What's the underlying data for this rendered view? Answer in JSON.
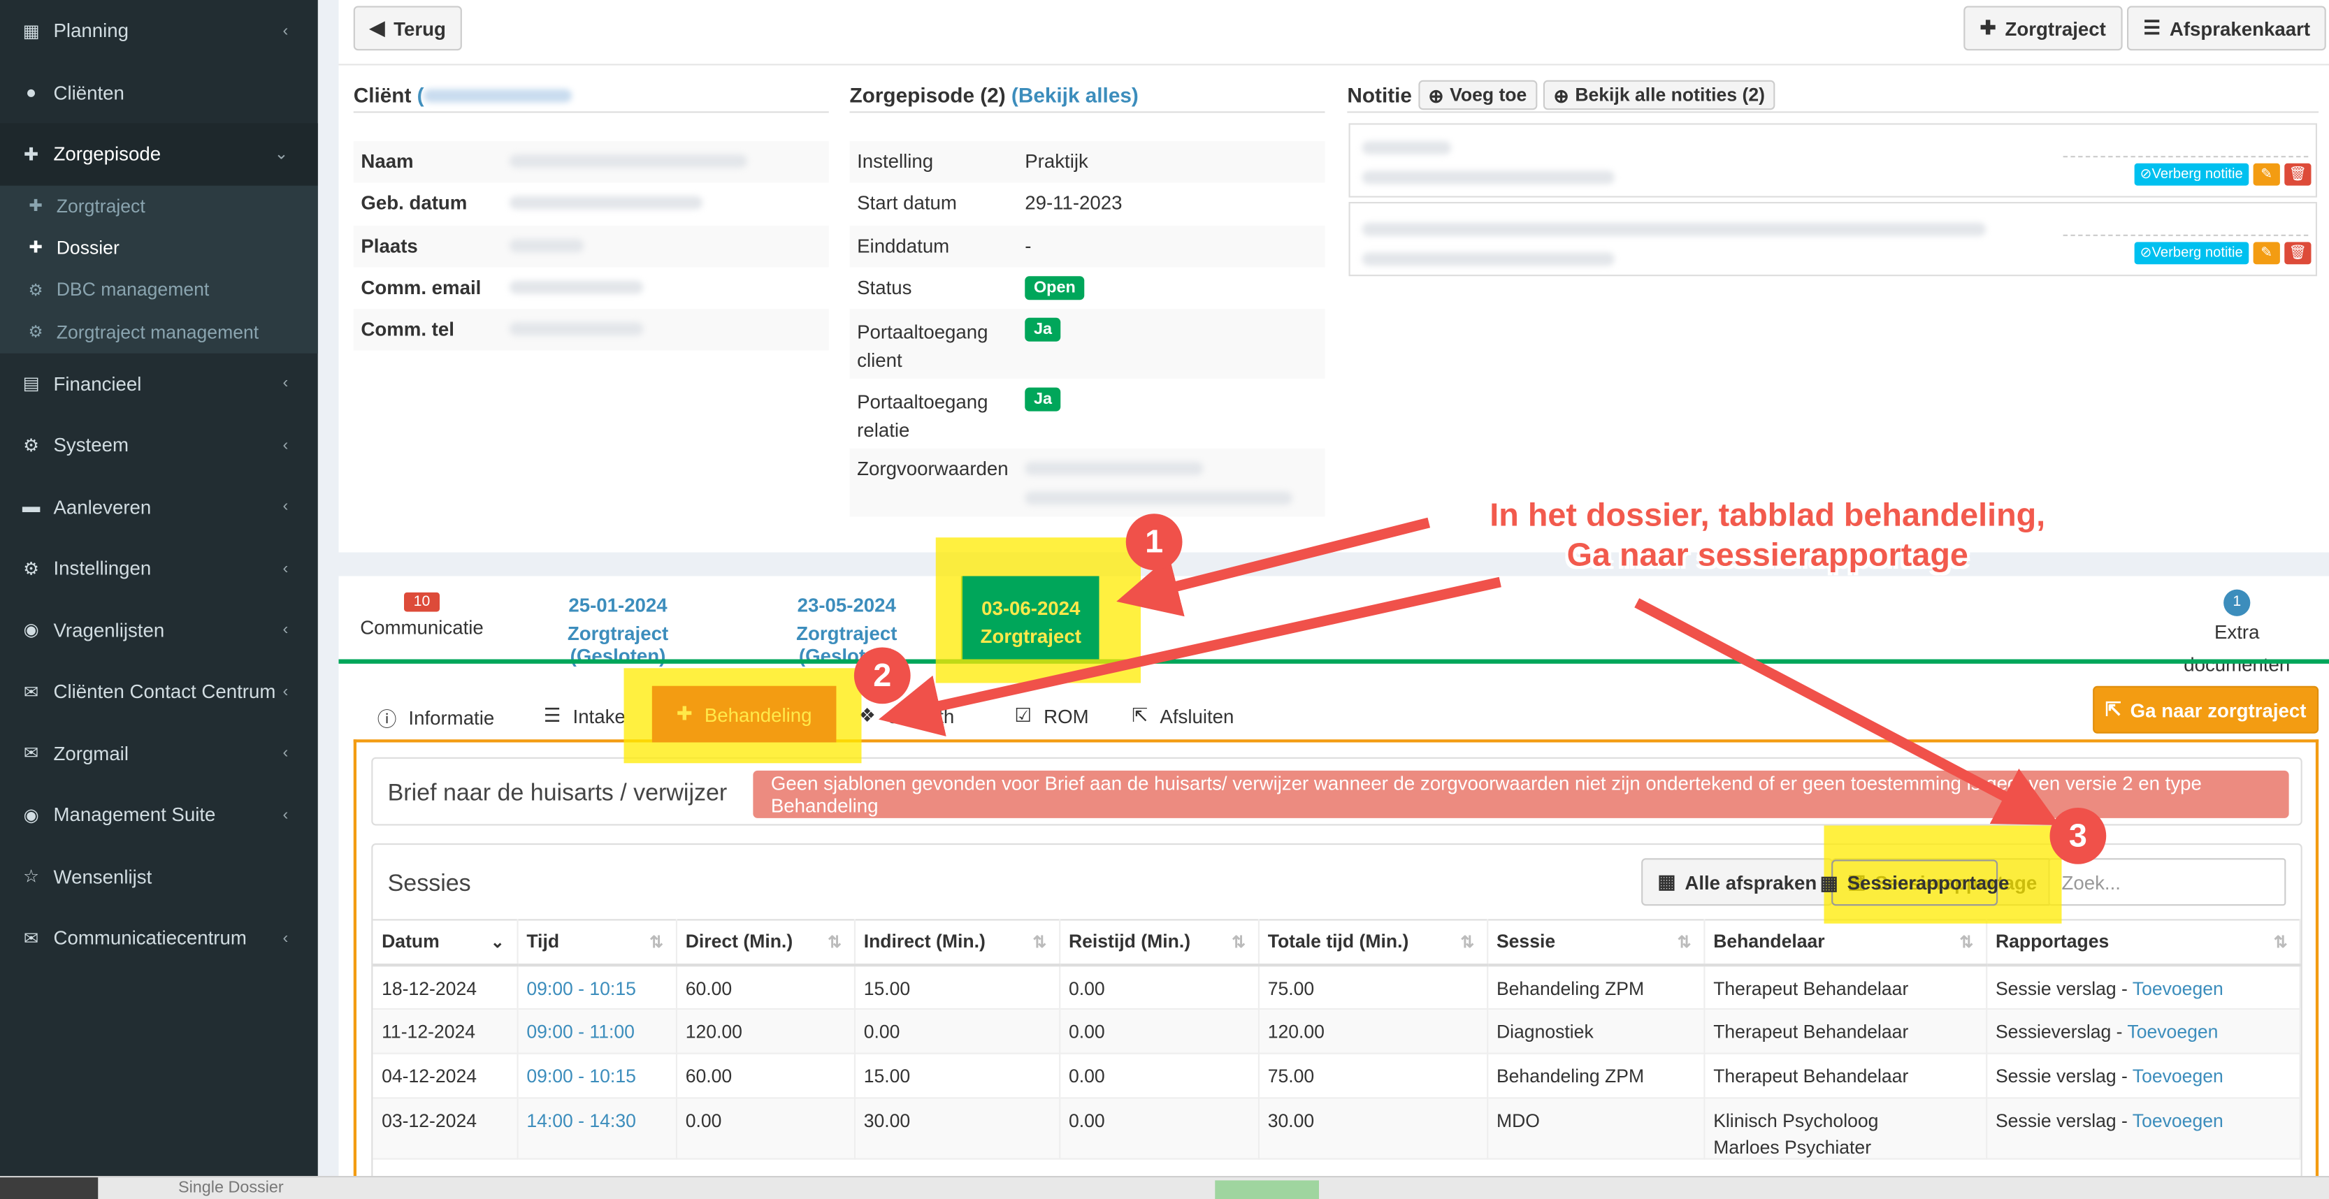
{
  "sidebar": {
    "items": [
      {
        "label": "Planning",
        "icon": "calendar-icon",
        "glyph": "▦",
        "chevron": "‹"
      },
      {
        "label": "Cliënten",
        "icon": "user-icon",
        "glyph": "●",
        "chevron": ""
      },
      {
        "label": "Zorgepisode",
        "icon": "medkit-icon",
        "glyph": "✚",
        "chevron": "⌄"
      },
      {
        "label": "Financieel",
        "icon": "book-icon",
        "glyph": "▤",
        "chevron": "‹"
      },
      {
        "label": "Systeem",
        "icon": "cogs-icon",
        "glyph": "⚙",
        "chevron": "‹"
      },
      {
        "label": "Aanleveren",
        "icon": "truck-icon",
        "glyph": "▬",
        "chevron": "‹"
      },
      {
        "label": "Instellingen",
        "icon": "gear-icon",
        "glyph": "⚙",
        "chevron": "‹"
      },
      {
        "label": "Vragenlijsten",
        "icon": "globe-icon",
        "glyph": "◉",
        "chevron": "‹"
      },
      {
        "label": "Cliënten Contact Centrum",
        "icon": "envelope-icon",
        "glyph": "✉",
        "chevron": "‹"
      },
      {
        "label": "Zorgmail",
        "icon": "envelope-icon",
        "glyph": "✉",
        "chevron": "‹"
      },
      {
        "label": "Management Suite",
        "icon": "globe-icon",
        "glyph": "◉",
        "chevron": "‹"
      },
      {
        "label": "Wensenlijst",
        "icon": "star-icon",
        "glyph": "☆",
        "chevron": ""
      },
      {
        "label": "Communicatiecentrum",
        "icon": "envelope-icon",
        "glyph": "✉",
        "chevron": "‹"
      }
    ],
    "subitems": [
      {
        "label": "Zorgtraject",
        "glyph": "✚"
      },
      {
        "label": "Dossier",
        "glyph": "✚"
      },
      {
        "label": "DBC management",
        "glyph": "⚙"
      },
      {
        "label": "Zorgtraject management",
        "glyph": "⚙"
      }
    ]
  },
  "header": {
    "back_label": "Terug",
    "zorgtraject_label": "Zorgtraject",
    "afsprakenkaart_label": "Afsprakenkaart"
  },
  "client": {
    "title": "Cliënt",
    "paren_open": "(",
    "fields": [
      "Naam",
      "Geb. datum",
      "Plaats",
      "Comm. email",
      "Comm. tel"
    ]
  },
  "episode": {
    "title": "Zorgepisode (2)",
    "link": "(Bekijk alles)",
    "rows": [
      {
        "k": "Instelling",
        "v": "Praktijk"
      },
      {
        "k": "Start datum",
        "v": "29-11-2023"
      },
      {
        "k": "Einddatum",
        "v": "-"
      },
      {
        "k": "Status",
        "badge": "Open"
      },
      {
        "k": "Portaaltoegang client",
        "badge": "Ja"
      },
      {
        "k": "Portaaltoegang relatie",
        "badge": "Ja"
      },
      {
        "k": "Zorgvoorwaarden",
        "v": ""
      }
    ]
  },
  "notitie": {
    "title": "Notitie",
    "add_label": "Voeg toe",
    "view_all_label": "Bekijk alle notities (2)",
    "hide_label": "Verberg notitie"
  },
  "tabs": {
    "communicatie": {
      "badge": "10",
      "label": "Communicatie"
    },
    "t1": {
      "date": "25-01-2024",
      "label": "Zorgtraject (Gesloten)"
    },
    "t2": {
      "date": "23-05-2024",
      "label": "Zorgtraject (Gesloten)"
    },
    "t3": {
      "date": "03-06-2024",
      "label": "Zorgtraject"
    },
    "extra": {
      "badge": "1",
      "label": "Extra documenten"
    }
  },
  "subtabs": {
    "informatie": "Informatie",
    "intake": "Intake",
    "behandeling": "Behandeling",
    "ehealth": "eHealth",
    "rom": "ROM",
    "afsluiten": "Afsluiten"
  },
  "ga_naar_label": "Ga naar zorgtraject",
  "brief": {
    "title": "Brief naar de huisarts / verwijzer",
    "alert": "Geen sjablonen gevonden voor Brief aan de huisarts/ verwijzer wanneer de zorgvoorwaarden niet zijn ondertekend of er geen toestemming is gegeven versie 2 en type Behandeling"
  },
  "sessies": {
    "title": "Sessies",
    "alle_label": "Alle afspraken",
    "sessie_label": "Sessierapportage",
    "search_placeholder": "Zoek...",
    "columns": [
      "Datum",
      "Tijd",
      "Direct (Min.)",
      "Indirect (Min.)",
      "Reistijd (Min.)",
      "Totale tijd (Min.)",
      "Sessie",
      "Behandelaar",
      "Rapportages"
    ],
    "rows": [
      {
        "datum": "18-12-2024",
        "tijd": "09:00 - 10:15",
        "direct": "60.00",
        "indirect": "15.00",
        "reis": "0.00",
        "totaal": "75.00",
        "sessie": "Behandeling ZPM",
        "behandelaar": "Therapeut Behandelaar",
        "rap": "Sessie verslag - ",
        "rap_link": "Toevoegen"
      },
      {
        "datum": "11-12-2024",
        "tijd": "09:00 - 11:00",
        "direct": "120.00",
        "indirect": "0.00",
        "reis": "0.00",
        "totaal": "120.00",
        "sessie": "Diagnostiek",
        "behandelaar": "Therapeut Behandelaar",
        "rap": "Sessieverslag - ",
        "rap_link": "Toevoegen"
      },
      {
        "datum": "04-12-2024",
        "tijd": "09:00 - 10:15",
        "direct": "60.00",
        "indirect": "15.00",
        "reis": "0.00",
        "totaal": "75.00",
        "sessie": "Behandeling ZPM",
        "behandelaar": "Therapeut Behandelaar",
        "rap": "Sessie verslag - ",
        "rap_link": "Toevoegen"
      },
      {
        "datum": "03-12-2024",
        "tijd": "14:00 - 14:30",
        "direct": "0.00",
        "indirect": "30.00",
        "reis": "0.00",
        "totaal": "30.00",
        "sessie": "MDO",
        "behandelaar": "Klinisch Psycholoog",
        "behandelaar2": "Marloes Psychiater",
        "rap": "Sessie verslag - ",
        "rap_link": "Toevoegen"
      }
    ]
  },
  "annotations": {
    "one": "1",
    "two": "2",
    "three": "3",
    "line1": "In het dossier, tabblad behandeling,",
    "line2": "Ga naar sessierapportage"
  },
  "taskbar": {
    "text": "Single Dossier"
  },
  "colors": {
    "sidebar": "#222d32",
    "accent_green": "#00a65a",
    "accent_orange": "#f39c12",
    "link_blue": "#3c8dbc",
    "annotation_red": "#f0514a",
    "highlight_yellow": "#ffeb00"
  }
}
